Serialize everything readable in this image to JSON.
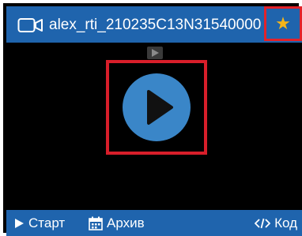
{
  "header": {
    "camera_icon": "camera-icon",
    "title": "alex_rti_210235C13N31540000",
    "favorite_icon": "star-icon"
  },
  "video": {
    "small_play_icon": "small-play-icon",
    "play_icon": "play-icon"
  },
  "footer": {
    "start_label": "Старт",
    "archive_label": "Архив",
    "code_label": "Код"
  },
  "colors": {
    "header_bg": "#1f64ad",
    "play_circle": "#3a86c8",
    "highlight_border": "#d81e2a",
    "star": "#f5b51a"
  }
}
